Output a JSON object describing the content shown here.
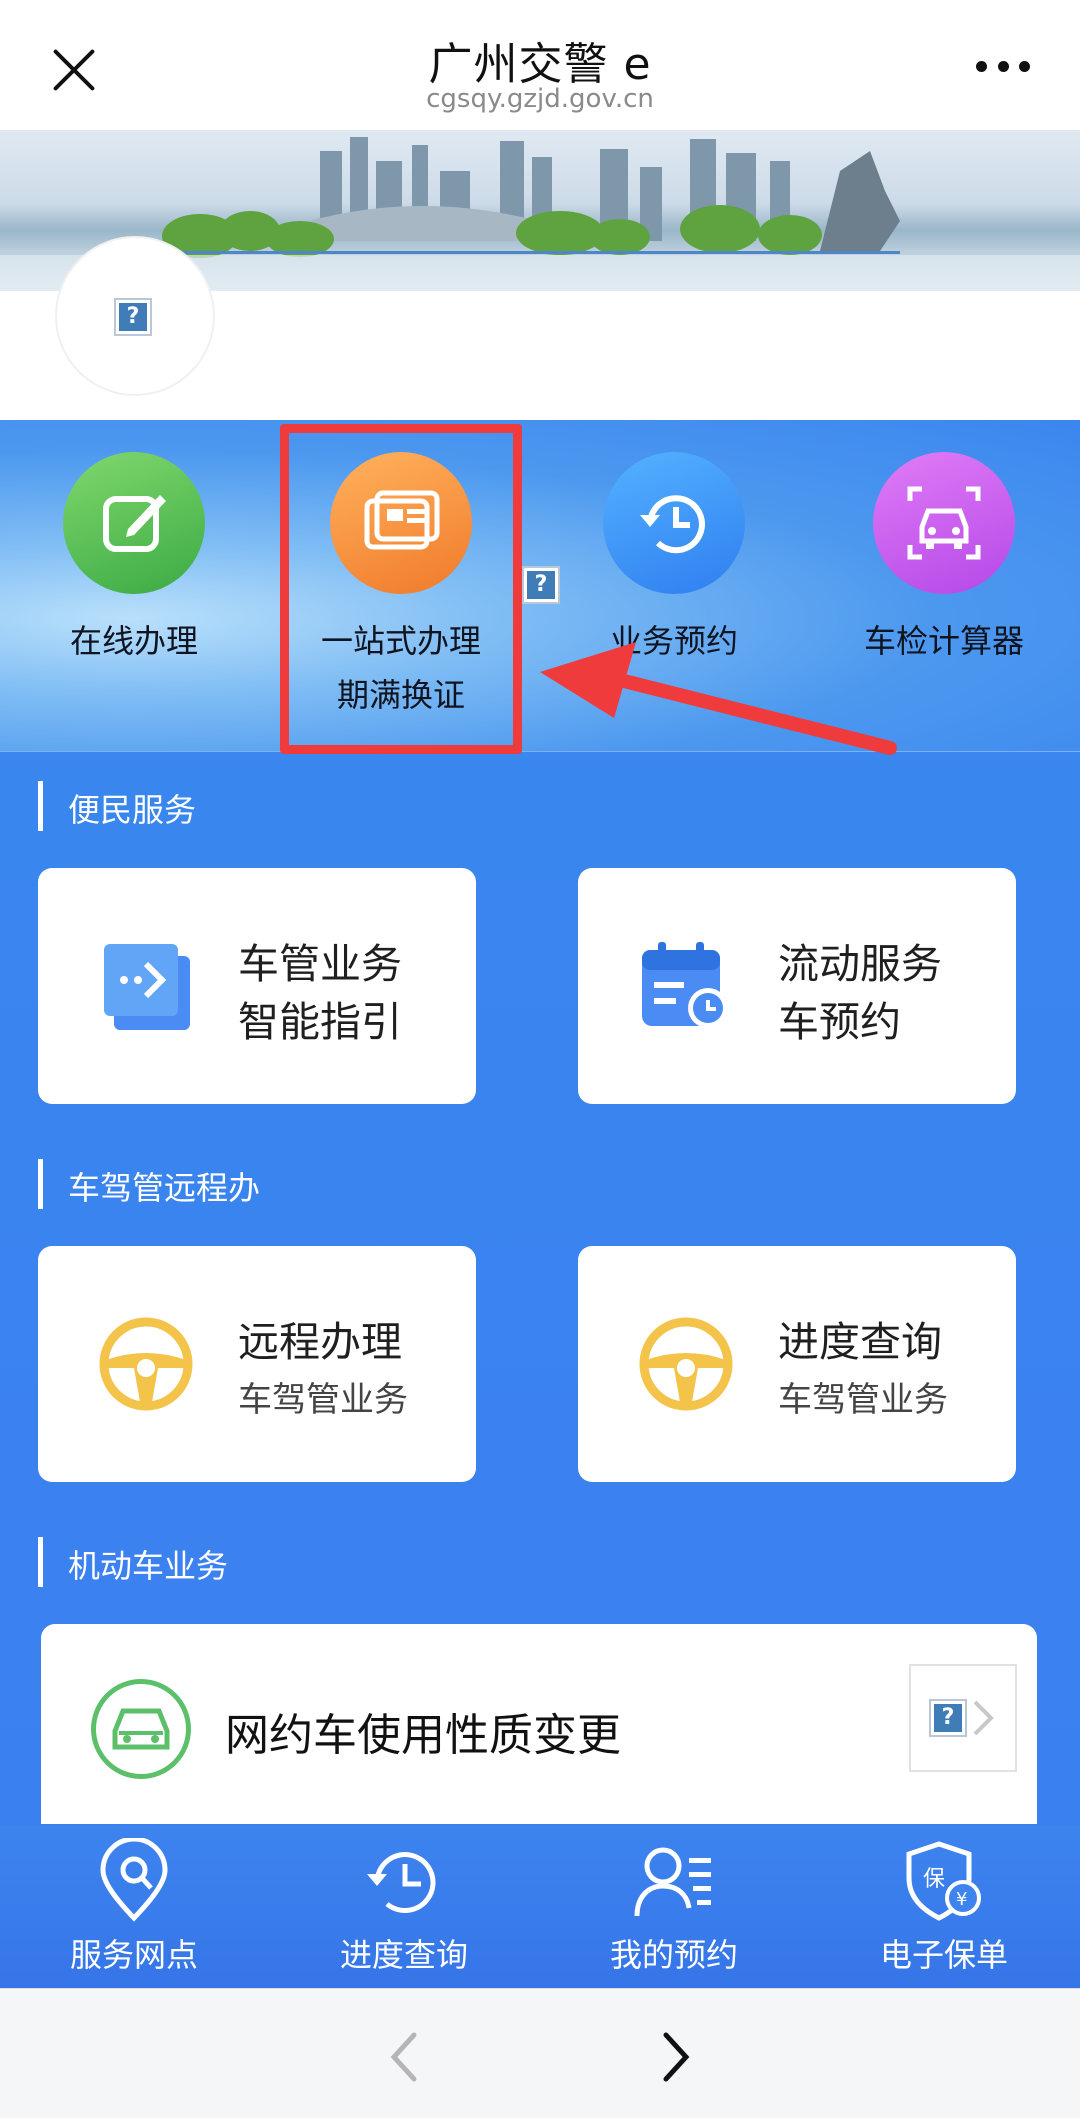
{
  "header": {
    "title": "广州交警 e",
    "url": "cgsqy.gzjd.gov.cn"
  },
  "quick_actions": [
    {
      "label": "在线办理",
      "icon": "edit-icon"
    },
    {
      "label": "一站式办理\n期满换证",
      "line1": "一站式办理",
      "line2": "期满换证",
      "icon": "id-card-icon"
    },
    {
      "label": "业务预约",
      "icon": "clock-history-icon"
    },
    {
      "label": "车检计算器",
      "icon": "car-scan-icon"
    }
  ],
  "sections": {
    "convenience": {
      "title": "便民服务",
      "cards": [
        {
          "line1": "车管业务",
          "line2": "智能指引",
          "icon": "guide-arrow-icon"
        },
        {
          "line1": "流动服务",
          "line2": "车预约",
          "icon": "calendar-clock-icon"
        }
      ]
    },
    "remote": {
      "title": "车驾管远程办",
      "cards": [
        {
          "line1": "远程办理",
          "line2": "车驾管业务",
          "icon": "steering-wheel-icon"
        },
        {
          "line1": "进度查询",
          "line2": "车驾管业务",
          "icon": "steering-wheel-icon"
        }
      ]
    },
    "vehicle": {
      "title": "机动车业务",
      "item": {
        "label": "网约车使用性质变更",
        "icon": "car-icon"
      }
    }
  },
  "tabbar": [
    {
      "label": "服务网点",
      "icon": "location-pin-icon"
    },
    {
      "label": "进度查询",
      "icon": "clock-history-icon"
    },
    {
      "label": "我的预约",
      "icon": "user-list-icon"
    },
    {
      "label": "电子保单",
      "icon": "shield-yuan-icon"
    }
  ],
  "colors": {
    "primary_blue": "#3b80f0",
    "highlight_red": "#ef3b3b",
    "green": "#3caa45",
    "orange": "#f07a2a",
    "purple": "#b548e8",
    "wheel_yellow": "#f3c34a"
  }
}
